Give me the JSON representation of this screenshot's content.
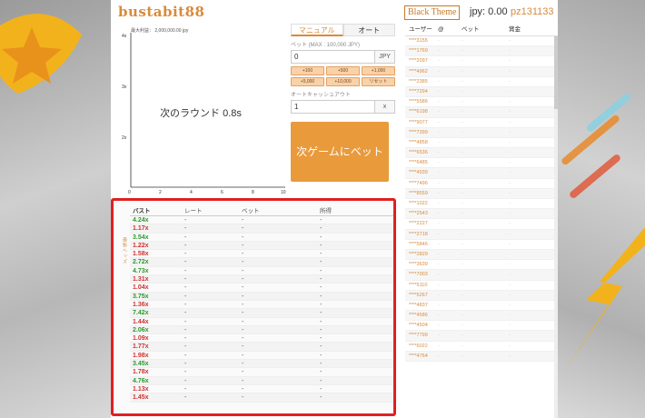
{
  "header": {
    "logo": "bustabit88",
    "theme_button": "Black Theme",
    "balance": "jpy: 0.00",
    "username": "pz131133"
  },
  "chart": {
    "max_profit": "最大利益： 2,000,000.00 jpy",
    "status": "次のラウンド 0.8s",
    "y_ticks": [
      "4x",
      "3x",
      "2x"
    ],
    "x_ticks": [
      "0",
      "2",
      "4",
      "6",
      "8",
      "10"
    ]
  },
  "bet": {
    "tabs": [
      "マニュアル",
      "オート"
    ],
    "bet_label": "ベット (MAX : 100,000 JPY)",
    "bet_value": "0",
    "currency": "JPY",
    "chips": [
      "+100",
      "+500",
      "+1,000",
      "+5,000",
      "+10,000",
      "リセット"
    ],
    "auto_cashout_label": "オートキャッシュアウト",
    "auto_cashout_value": "1",
    "clear_label": "x",
    "bet_button": "次ゲームにベット"
  },
  "history": {
    "side_label": "最新ヘッズ",
    "headers": [
      "バスト",
      "レート",
      "ベット",
      "所得"
    ],
    "rows": [
      {
        "bust": "4.24x",
        "color": "green"
      },
      {
        "bust": "1.17x",
        "color": "red"
      },
      {
        "bust": "3.54x",
        "color": "green"
      },
      {
        "bust": "1.22x",
        "color": "red"
      },
      {
        "bust": "1.58x",
        "color": "red"
      },
      {
        "bust": "2.72x",
        "color": "green"
      },
      {
        "bust": "4.73x",
        "color": "green"
      },
      {
        "bust": "1.31x",
        "color": "red"
      },
      {
        "bust": "1.04x",
        "color": "red"
      },
      {
        "bust": "3.75x",
        "color": "green"
      },
      {
        "bust": "1.36x",
        "color": "red"
      },
      {
        "bust": "7.42x",
        "color": "green"
      },
      {
        "bust": "1.44x",
        "color": "red"
      },
      {
        "bust": "2.06x",
        "color": "green"
      },
      {
        "bust": "1.09x",
        "color": "red"
      },
      {
        "bust": "1.77x",
        "color": "red"
      },
      {
        "bust": "1.98x",
        "color": "red"
      },
      {
        "bust": "3.45x",
        "color": "green"
      },
      {
        "bust": "1.78x",
        "color": "red"
      },
      {
        "bust": "4.76x",
        "color": "green"
      },
      {
        "bust": "1.13x",
        "color": "red"
      },
      {
        "bust": "1.45x",
        "color": "red"
      }
    ],
    "dash": "-"
  },
  "players": {
    "headers": [
      "ユーザー",
      "@",
      "ベット",
      "賞金"
    ],
    "dash": "-",
    "users": [
      "****3155",
      "****1769",
      "****2097",
      "****4962",
      "****2385",
      "****7294",
      "****5586",
      "****6198",
      "****9077",
      "****7399",
      "****4858",
      "****6536",
      "****6485",
      "****4539",
      "****7496",
      "****8559",
      "****1022",
      "****2543",
      "****2227",
      "****2718",
      "****5846",
      "****2829",
      "****3639",
      "****7003",
      "****5110",
      "****5267",
      "****4837",
      "****4586",
      "****4504",
      "****7799",
      "****6022",
      "****4764"
    ]
  },
  "colors": {
    "accent": "#d98a3a",
    "bet_button": "#e99a3b",
    "highlight_border": "#e02020",
    "bust_green": "#2a9a2a",
    "bust_red": "#d03030"
  }
}
